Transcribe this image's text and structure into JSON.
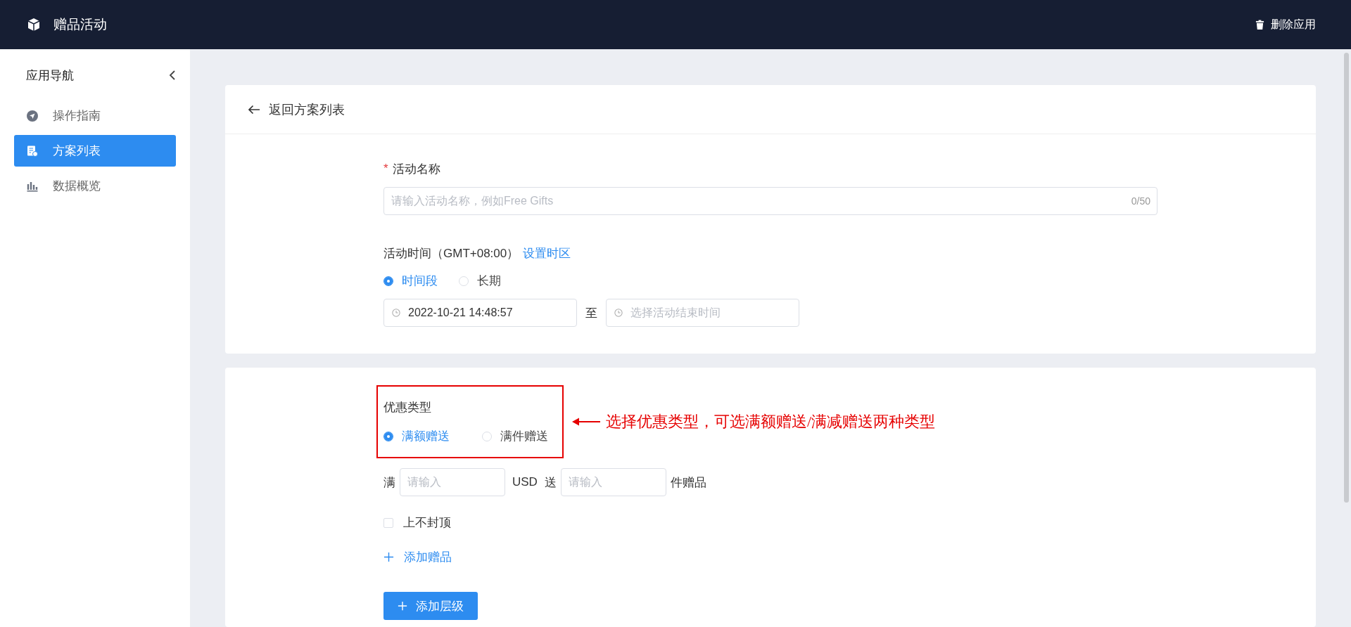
{
  "header": {
    "title": "赠品活动",
    "action": "删除应用"
  },
  "sidebar": {
    "title": "应用导航",
    "items": [
      {
        "label": "操作指南",
        "kind": "guide",
        "selected": false
      },
      {
        "label": "方案列表",
        "kind": "list",
        "selected": true
      },
      {
        "label": "数据概览",
        "kind": "chart",
        "selected": false
      }
    ]
  },
  "back_link": "返回方案列表",
  "basic": {
    "name_label": "活动名称",
    "required_mark": "*",
    "name_placeholder": "请输入活动名称，例如Free Gifts",
    "name_counter": "0/50",
    "time_label": "活动时间（GMT+08:00）",
    "timezone_link": "设置时区",
    "time_modes": [
      {
        "label": "时间段",
        "selected": true
      },
      {
        "label": "长期",
        "selected": false
      }
    ],
    "start_value": "2022-10-21 14:48:57",
    "separator": "至",
    "end_placeholder": "选择活动结束时间"
  },
  "promo": {
    "type_label": "优惠类型",
    "types": [
      {
        "label": "满额赠送",
        "selected": true
      },
      {
        "label": "满件赠送",
        "selected": false
      }
    ],
    "rule": {
      "prefix": "满",
      "amount_placeholder": "请输入",
      "unit": "USD",
      "middle": "送",
      "count_placeholder": "请输入",
      "suffix": "件赠品"
    },
    "no_cap": {
      "label": "上不封顶",
      "checked": false
    },
    "add_gift": "添加赠品",
    "add_tier": "添加层级"
  },
  "annotation": "选择优惠类型，可选满额赠送/满减赠送两种类型"
}
